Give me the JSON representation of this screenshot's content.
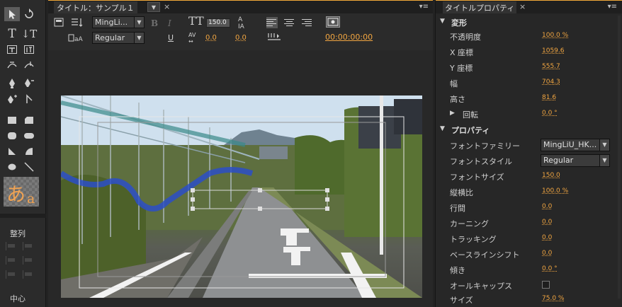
{
  "title_panel": {
    "tab_label": "タイトル：サンプル１",
    "font_family": "MingLi...",
    "font_style": "Regular",
    "font_size": "150.0",
    "kerning": "0.0",
    "tracking": "0.0",
    "timecode": "00:00:00:00"
  },
  "tools_panel": {
    "swatch_char1": "あ",
    "swatch_char2": "a",
    "align_label": "整列",
    "center_label": "中心"
  },
  "properties_panel": {
    "tab_label": "タイトルプロパティ",
    "transform": {
      "section": "変形",
      "opacity_label": "不透明度",
      "opacity": "100.0 %",
      "x_label": "X 座標",
      "x": "1059.6",
      "y_label": "Y 座標",
      "y": "555.7",
      "width_label": "幅",
      "width": "704.3",
      "height_label": "高さ",
      "height": "81.6",
      "rotation_label": "回転",
      "rotation": "0.0 °"
    },
    "properties": {
      "section": "プロパティ",
      "font_family_label": "フォントファミリー",
      "font_family": "MingLiU_HK...",
      "font_style_label": "フォントスタイル",
      "font_style": "Regular",
      "font_size_label": "フォントサイズ",
      "font_size": "150.0",
      "aspect_label": "縦横比",
      "aspect": "100.0 %",
      "leading_label": "行間",
      "leading": "0.0",
      "kerning_label": "カーニング",
      "kerning": "0.0",
      "tracking_label": "トラッキング",
      "tracking": "0.0",
      "baseline_label": "ベースラインシフト",
      "baseline": "0.0",
      "slant_label": "傾き",
      "slant": "0.0 °",
      "allcaps_label": "オールキャップス",
      "size_label": "サイズ",
      "size": "75.0 %"
    }
  },
  "colors": {
    "accent": "#f2a641",
    "panel_bg": "#282828",
    "frame_bg": "#1f1f1f"
  }
}
